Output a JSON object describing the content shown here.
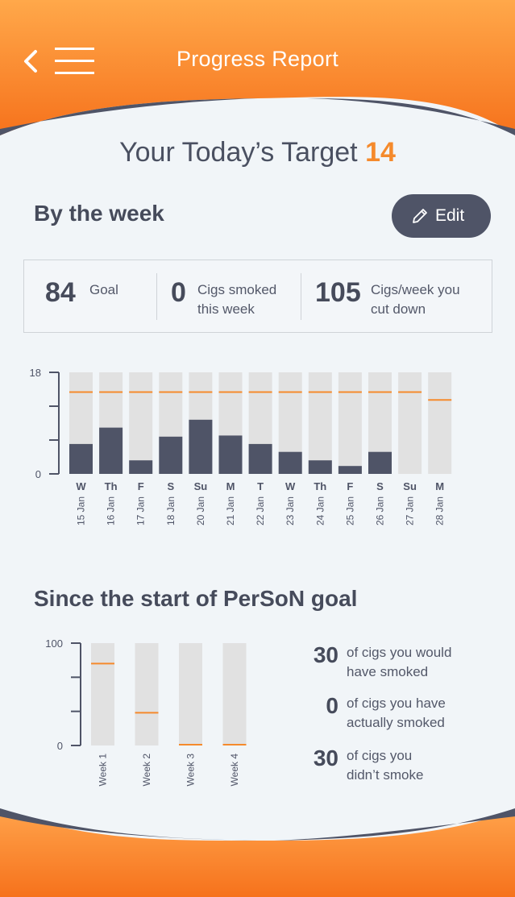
{
  "header": {
    "title": "Progress Report",
    "back_icon": "chevron-left-icon",
    "menu_icon": "hamburger-menu-icon"
  },
  "target": {
    "prefix": "Your Today’s Target",
    "value": "14"
  },
  "week": {
    "heading": "By the week",
    "edit_label": "Edit",
    "edit_icon": "pencil-icon"
  },
  "stats": [
    {
      "value": "84",
      "label_line1": "Goal",
      "label_line2": ""
    },
    {
      "value": "0",
      "label_line1": "Cigs smoked",
      "label_line2": "this week"
    },
    {
      "value": "105",
      "label_line1": "Cigs/week you",
      "label_line2": "cut down"
    }
  ],
  "since": {
    "heading": "Since the start of PerSoN goal",
    "stats": [
      {
        "value": "30",
        "line1": "of cigs you would",
        "line2": "have smoked"
      },
      {
        "value": "0",
        "line1": "of cigs you have",
        "line2": "actually smoked"
      },
      {
        "value": "30",
        "line1": "of cigs you",
        "line2": "didn’t smoke"
      }
    ]
  },
  "colors": {
    "orange": "#f58a2c",
    "dark": "#4f5467",
    "track": "#e1e1e1"
  },
  "chart_data": [
    {
      "type": "bar",
      "ylim": [
        0,
        18
      ],
      "y_tick_labels": [
        "18",
        "0"
      ],
      "categories": [
        "W",
        "Th",
        "F",
        "S",
        "Su",
        "M",
        "T",
        "W",
        "Th",
        "F",
        "S",
        "Su",
        "M"
      ],
      "dates": [
        "15 Jan",
        "16 Jan",
        "17 Jan",
        "18 Jan",
        "20 Jan",
        "21 Jan",
        "22 Jan",
        "23 Jan",
        "24 Jan",
        "25 Jan",
        "26 Jan",
        "27 Jan",
        "28 Jan"
      ],
      "series": [
        {
          "values": [
            5.3,
            8.2,
            2.4,
            6.6,
            9.6,
            6.8,
            5.3,
            3.9,
            2.4,
            1.4,
            3.9,
            0,
            0
          ]
        }
      ],
      "target_line": [
        14.5,
        14.5,
        14.5,
        14.5,
        14.5,
        14.5,
        14.5,
        14.5,
        14.5,
        14.5,
        14.5,
        14.5,
        13.1
      ]
    },
    {
      "type": "bar",
      "ylim": [
        0,
        100
      ],
      "y_tick_labels": [
        "100",
        "0"
      ],
      "categories": [
        "Week 1",
        "Week 2",
        "Week 3",
        "Week 4"
      ],
      "target_line": [
        80,
        32,
        0,
        0
      ]
    }
  ]
}
